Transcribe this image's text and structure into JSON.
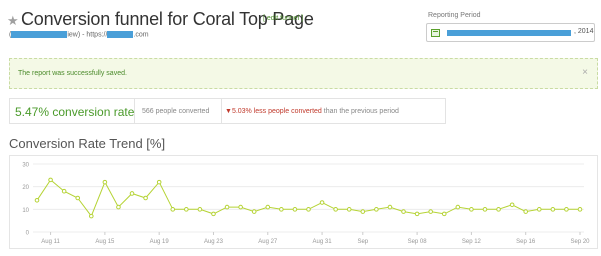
{
  "header": {
    "title": "Conversion funnel for Coral Top Page",
    "edit_label": "[ edit funnel ]",
    "subtitle_prefix": "(",
    "subtitle_mid": "iew) - https://",
    "subtitle_suffix": ".com"
  },
  "reporting_period": {
    "label": "Reporting Period",
    "year_text": ", 2014",
    "icon": "calendar-icon"
  },
  "alert": {
    "message": "The report was successfully saved.",
    "close_glyph": "×"
  },
  "stats": {
    "conversion_rate": "5.47% conversion rate",
    "people_converted": "566 people converted",
    "compare_arrow": "▼",
    "compare_highlight": "5.03% less people converted",
    "compare_rest": " than the previous period"
  },
  "chart_section": {
    "title": "Conversion Rate Trend [%]"
  },
  "colors": {
    "accent_green": "#4a9a2a",
    "line_green": "#b5d334",
    "negative_red": "#c0392b",
    "redaction_blue": "#4a9fd8"
  },
  "chart_data": {
    "type": "line",
    "title": "Conversion Rate Trend [%]",
    "xlabel": "",
    "ylabel": "",
    "ylim": [
      0,
      30
    ],
    "yticks": [
      "0",
      "10",
      "20",
      "30"
    ],
    "grid": true,
    "series": [
      {
        "values": [
          14,
          23,
          18,
          15,
          7,
          22,
          11,
          17,
          15,
          22,
          10,
          10,
          10,
          8,
          11,
          11,
          9,
          11,
          10,
          10,
          10,
          13,
          10,
          10,
          9,
          10,
          11,
          9,
          8,
          9,
          8,
          11,
          10,
          10,
          10,
          12,
          9,
          10,
          10,
          10,
          10
        ]
      }
    ],
    "xticks": [
      {
        "index": 1,
        "label": "Aug 11"
      },
      {
        "index": 5,
        "label": "Aug 15"
      },
      {
        "index": 9,
        "label": "Aug 19"
      },
      {
        "index": 13,
        "label": "Aug 23"
      },
      {
        "index": 17,
        "label": "Aug 27"
      },
      {
        "index": 21,
        "label": "Aug 31"
      },
      {
        "index": 24,
        "label": "Sep"
      },
      {
        "index": 28,
        "label": "Sep 08"
      },
      {
        "index": 32,
        "label": "Sep 12"
      },
      {
        "index": 36,
        "label": "Sep 16"
      },
      {
        "index": 40,
        "label": "Sep 20"
      }
    ]
  }
}
